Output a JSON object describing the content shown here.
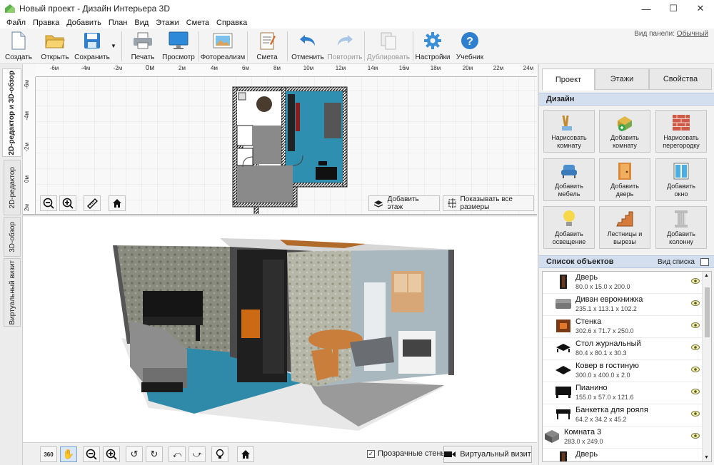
{
  "window": {
    "title": "Новый проект - Дизайн Интерьера 3D",
    "controls": [
      "—",
      "☐",
      "✕"
    ]
  },
  "menu": [
    "Файл",
    "Правка",
    "Добавить",
    "План",
    "Вид",
    "Этажи",
    "Смета",
    "Справка"
  ],
  "toolbar": {
    "buttons": [
      {
        "label": "Создать",
        "icon": "new-file-icon",
        "disabled": false
      },
      {
        "label": "Открыть",
        "icon": "open-folder-icon",
        "disabled": false
      },
      {
        "label": "Сохранить",
        "icon": "save-disk-icon",
        "disabled": false
      },
      {
        "label": "Печать",
        "icon": "printer-icon",
        "disabled": false
      },
      {
        "label": "Просмотр",
        "icon": "monitor-icon",
        "disabled": false
      },
      {
        "label": "Фотореализм",
        "icon": "photo-icon",
        "disabled": false
      },
      {
        "label": "Смета",
        "icon": "notepad-icon",
        "disabled": false
      },
      {
        "label": "Отменить",
        "icon": "undo-icon",
        "disabled": false
      },
      {
        "label": "Повторить",
        "icon": "redo-icon",
        "disabled": true
      },
      {
        "label": "Дублировать",
        "icon": "duplicate-icon",
        "disabled": true
      },
      {
        "label": "Настройки",
        "icon": "gear-icon",
        "disabled": false
      },
      {
        "label": "Учебник",
        "icon": "help-icon",
        "disabled": false
      }
    ],
    "panel_view_label": "Вид панели:",
    "panel_view_value": "Обычный"
  },
  "left_tabs": [
    "2D-редактор и 3D-обзор",
    "2D-редактор",
    "3D-обзор",
    "Виртуальный визит"
  ],
  "plan": {
    "ruler_top": [
      "-6м",
      "-4м",
      "-2м",
      "0м",
      "2м",
      "4м",
      "6м",
      "8м",
      "10м",
      "12м",
      "14м",
      "16м",
      "18м",
      "20м",
      "22м",
      "24м"
    ],
    "ruler_left": [
      "-6м",
      "-4м",
      "-2м",
      "0м",
      "2м"
    ],
    "add_floor_label": "Добавить этаж",
    "show_sizes_label": "Показывать все размеры"
  },
  "bottom": {
    "transparent_walls_label": "Прозрачные стены",
    "transparent_walls_checked": true,
    "virtual_visit_label": "Виртуальный визит"
  },
  "right_panel": {
    "tabs": [
      "Проект",
      "Этажи",
      "Свойства"
    ],
    "design_header": "Дизайн",
    "design_buttons": [
      {
        "label": "Нарисовать\nкомнату",
        "icon": "draw-room-icon"
      },
      {
        "label": "Добавить\nкомнату",
        "icon": "add-room-icon"
      },
      {
        "label": "Нарисовать\nперегородку",
        "icon": "brick-wall-icon"
      },
      {
        "label": "Добавить\nмебель",
        "icon": "armchair-icon"
      },
      {
        "label": "Добавить\nдверь",
        "icon": "door-icon"
      },
      {
        "label": "Добавить\nокно",
        "icon": "window-icon"
      },
      {
        "label": "Добавить\nосвещение",
        "icon": "light-bulb-icon"
      },
      {
        "label": "Лестницы и\nвырезы",
        "icon": "stairs-icon"
      },
      {
        "label": "Добавить\nколонну",
        "icon": "column-icon"
      }
    ],
    "objects_header": "Список объектов",
    "list_view_label": "Вид списка",
    "objects": [
      {
        "name": "Дверь",
        "size": "80.0 x 15.0 x 200.0",
        "icon": "door-thumb-icon"
      },
      {
        "name": "Диван еврокнижка",
        "size": "235.1 x 113.1 x 102.2",
        "icon": "sofa-thumb-icon"
      },
      {
        "name": "Стенка",
        "size": "302.6 x 71.7 x 250.0",
        "icon": "wall-unit-thumb-icon"
      },
      {
        "name": "Стол журнальный",
        "size": "80.4 x 80.1 x 30.3",
        "icon": "coffee-table-thumb-icon"
      },
      {
        "name": "Ковер в гостиную",
        "size": "300.0 x 400.0 x 2.0",
        "icon": "carpet-thumb-icon"
      },
      {
        "name": "Пианино",
        "size": "155.0 x 57.0 x 121.6",
        "icon": "piano-thumb-icon"
      },
      {
        "name": "Банкетка для рояля",
        "size": "64.2 x 34.2 x 45.2",
        "icon": "bench-thumb-icon"
      },
      {
        "name": "Комната 3",
        "size": "283.0 x 249.0",
        "icon": "room-thumb-icon"
      },
      {
        "name": "Дверь",
        "size": "",
        "icon": "door-thumb-icon"
      }
    ]
  }
}
